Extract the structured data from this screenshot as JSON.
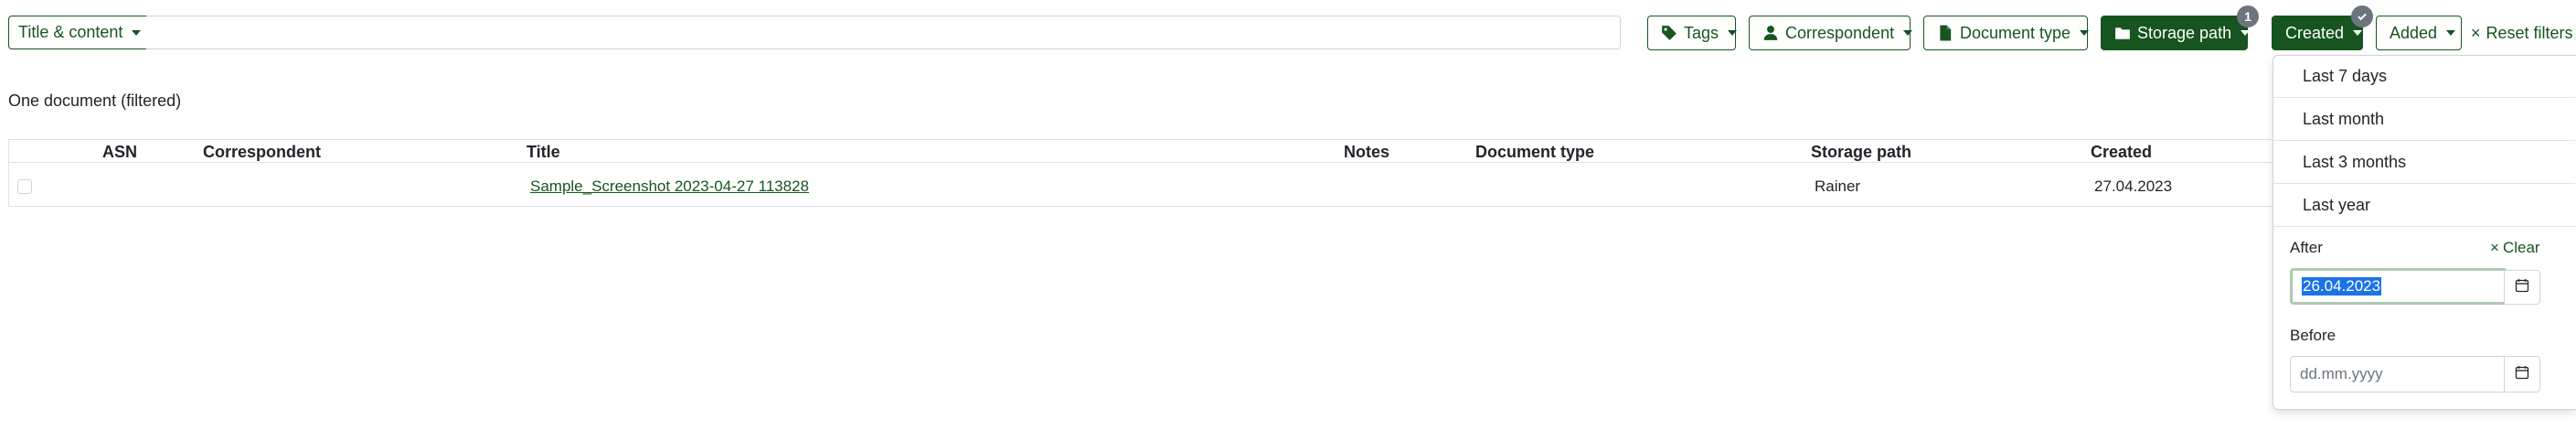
{
  "filters": {
    "text_mode_label": "Title & content",
    "text_query": "",
    "tags_label": "Tags",
    "correspondent_label": "Correspondent",
    "document_type_label": "Document type",
    "storage_path_label": "Storage path",
    "storage_path_count": "1",
    "created_label": "Created",
    "added_label": "Added",
    "reset_label": "Reset filters",
    "reset_icon": "×"
  },
  "results": {
    "summary": "One document (filtered)"
  },
  "table": {
    "columns": [
      "ASN",
      "Correspondent",
      "Title",
      "Notes",
      "Document type",
      "Storage path",
      "Created"
    ],
    "rows": [
      {
        "asn": "",
        "correspondent": "",
        "title": "Sample_Screenshot 2023-04-27 113828",
        "notes": "",
        "document_type": "",
        "storage_path": "Rainer",
        "created": "27.04.2023"
      }
    ]
  },
  "created_dropdown": {
    "quick_options": [
      "Last 7 days",
      "Last month",
      "Last 3 months",
      "Last year"
    ],
    "after_label": "After",
    "clear_label": "Clear",
    "clear_icon": "×",
    "after_value": "26.04.2023",
    "before_label": "Before",
    "before_placeholder": "dd.mm.yyyy"
  },
  "colors": {
    "primary": "#17541f",
    "badge": "#6c757d",
    "selection": "#1a73e8"
  }
}
